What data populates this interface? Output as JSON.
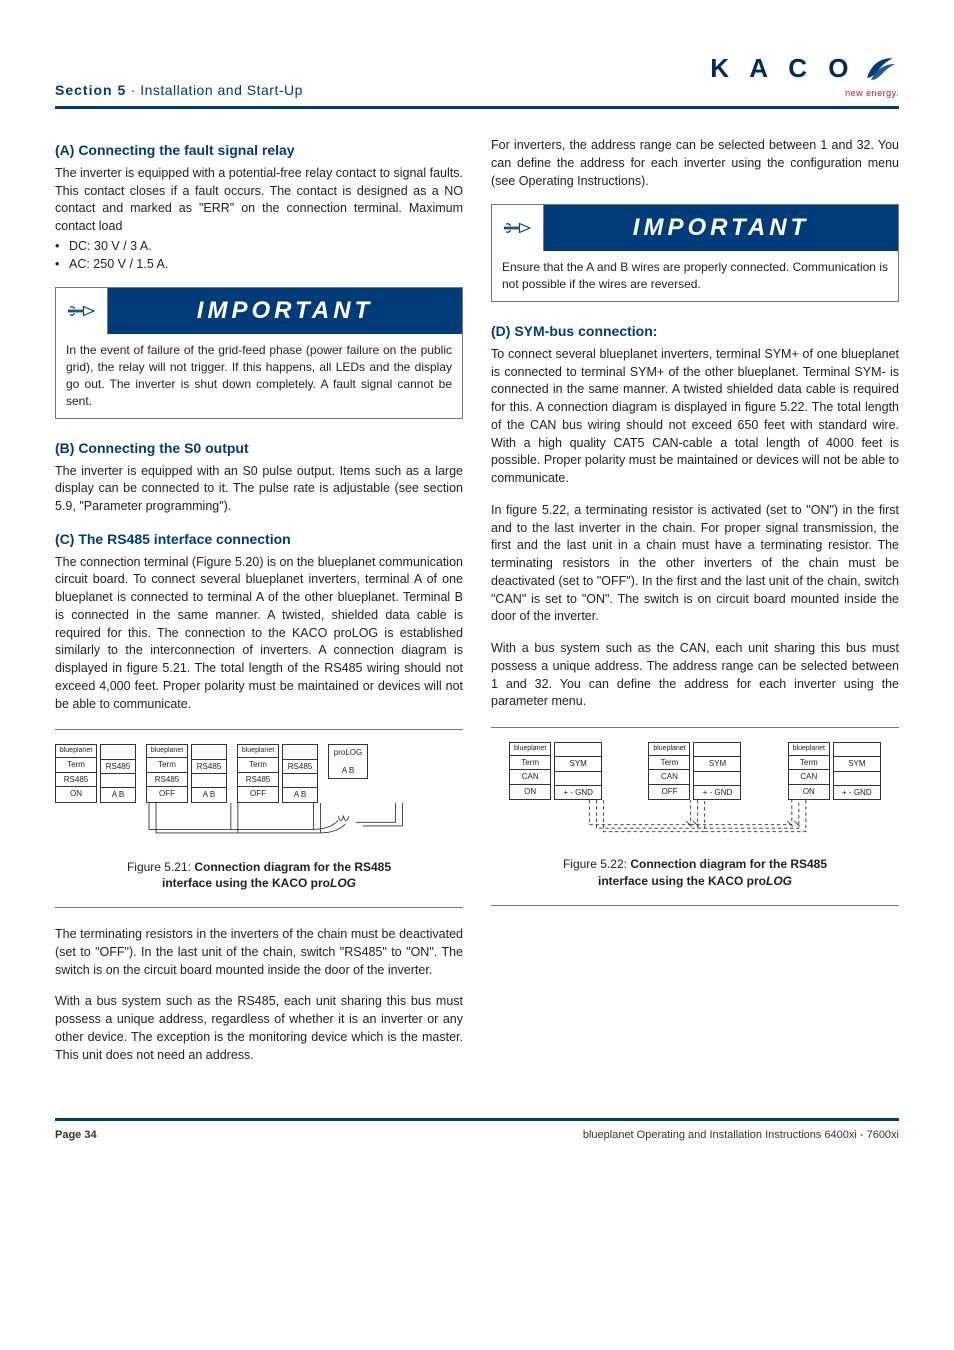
{
  "header": {
    "section": "Section 5",
    "dot": " · ",
    "title": "Installation and Start-Up",
    "logo_text": "K A C O",
    "logo_sub": "new energy."
  },
  "left": {
    "a_title": "(A)   Connecting the fault signal relay",
    "a_p1": "The inverter is equipped with a potential-free relay contact to signal faults. This contact closes if a fault occurs. The contact is designed as a NO contact and marked as \"ERR\" on the connection terminal. Maximum contact load",
    "a_b1": "DC: 30 V / 3 A.",
    "a_b2": "AC: 250 V / 1.5 A.",
    "imp_title": "IMPORTANT",
    "imp_body": "In the event of failure of the grid-feed phase (power failure on the public grid), the relay will not trigger. If this happens, all LEDs and the display go out. The inverter is shut down completely. A fault signal cannot be sent.",
    "b_title": "(B)   Connecting the S0 output",
    "b_p1": "The inverter is equipped with an S0 pulse output. Items such as a large display can be connected to it. The pulse rate is adjustable (see section 5.9, \"Parameter programming\").",
    "c_title": "(C)   The RS485 interface connection",
    "c_p1": "The connection terminal (Figure 5.20) is on the blueplanet communication circuit board. To connect several blueplanet inverters, terminal A of one blueplanet is connected to terminal A of the other blueplanet. Terminal B is connected in the same manner. A twisted, shielded data cable is required for this. The connection to the KACO proLOG is established similarly to the interconnection of inverters. A connection diagram is displayed in figure 5.21. The total length of the RS485 wiring should not exceed 4,000 feet. Proper polarity must be maintained or devices will not be able to communicate.",
    "diag521": {
      "bp": "blueplanet",
      "term": "Term",
      "rs485": "RS485",
      "on": "ON",
      "off": "OFF",
      "ab": "A   B",
      "prolog": "proLOG"
    },
    "fig521_pre": "Figure  5.21: ",
    "fig521_b1": "Connection diagram for the RS485 ",
    "fig521_b2": "interface using the KACO pro",
    "fig521_i": "LOG",
    "c_p2": "The terminating resistors in the inverters of the chain must be deactivated (set to \"OFF\"). In the last unit of the chain, switch \"RS485\" to \"ON\". The switch is on the circuit board mounted inside the door of the inverter.",
    "c_p3": "With a bus system such as the RS485, each unit sharing this bus must possess a unique address, regardless of whether it is an inverter or any other device.  The exception is the monitoring device which is the master.  This unit does not need an address."
  },
  "right": {
    "top_p": "For inverters, the address range can be selected between 1 and 32. You can define the address for each inverter using the configuration menu (see Operating Instructions).",
    "imp_title": "IMPORTANT",
    "imp_body": "Ensure that the A and B wires are properly connected. Communication is not possible if the wires are reversed.",
    "d_title": "(D)   SYM-bus connection:",
    "d_p1": "To connect several blueplanet inverters, terminal SYM+ of one blueplanet is connected to terminal SYM+ of the other blueplanet. Terminal SYM- is connected in the same manner. A twisted shielded data cable is required for this. A connection diagram is displayed in figure 5.22. The total length of the CAN bus wiring should not exceed 650 feet with standard wire. With a high quality CAT5 CAN-cable a total length of 4000 feet is possible. Proper polarity must be maintained or devices will not be able to communicate.",
    "d_p2": "In figure 5.22, a terminating resistor is activated (set to \"ON\") in the first and to the last inverter in the chain. For proper signal transmission, the first and the last unit in a chain must have a terminating resistor. The terminating resistors in the other inverters of the chain must be deactivated (set to \"OFF\"). In the first and the last unit of the chain, switch \"CAN\" is set to \"ON\". The switch is on circuit board mounted inside the door of the inverter.",
    "d_p3": "With a bus system such as the CAN, each unit sharing this bus must possess a unique address. The address range can be selected between 1 and 32. You can define the address for each inverter using the parameter menu.",
    "diag522": {
      "bp": "blueplanet",
      "term": "Term",
      "sym": "SYM",
      "can": "CAN",
      "on": "ON",
      "off": "OFF",
      "pmg": "+   -  GND"
    },
    "fig522_pre": "Figure  5.22: ",
    "fig522_b1": "Connection diagram for the RS485 ",
    "fig522_b2": "interface using the KACO pro",
    "fig522_i": "LOG"
  },
  "footer": {
    "left": "Page 34",
    "right": "blueplanet Operating and Installation Instructions 6400xi - 7600xi"
  }
}
